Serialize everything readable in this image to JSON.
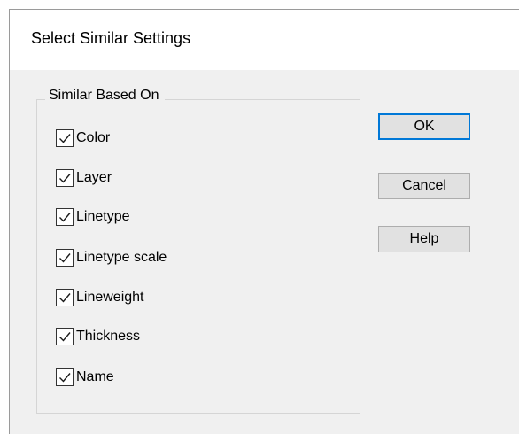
{
  "dialog": {
    "title": "Select Similar Settings"
  },
  "group": {
    "legend": "Similar Based On",
    "options": [
      {
        "label": "Color",
        "checked": true
      },
      {
        "label": "Layer",
        "checked": true
      },
      {
        "label": "Linetype",
        "checked": true
      },
      {
        "label": "Linetype scale",
        "checked": true
      },
      {
        "label": "Lineweight",
        "checked": true
      },
      {
        "label": "Thickness",
        "checked": true
      },
      {
        "label": "Name",
        "checked": true
      }
    ]
  },
  "buttons": {
    "ok": "OK",
    "cancel": "Cancel",
    "help": "Help"
  },
  "colors": {
    "default_button_border": "#0078d7",
    "dialog_background": "#f0f0f0",
    "title_background": "#ffffff"
  },
  "icons": {
    "checkbox": "checkmark-icon"
  }
}
